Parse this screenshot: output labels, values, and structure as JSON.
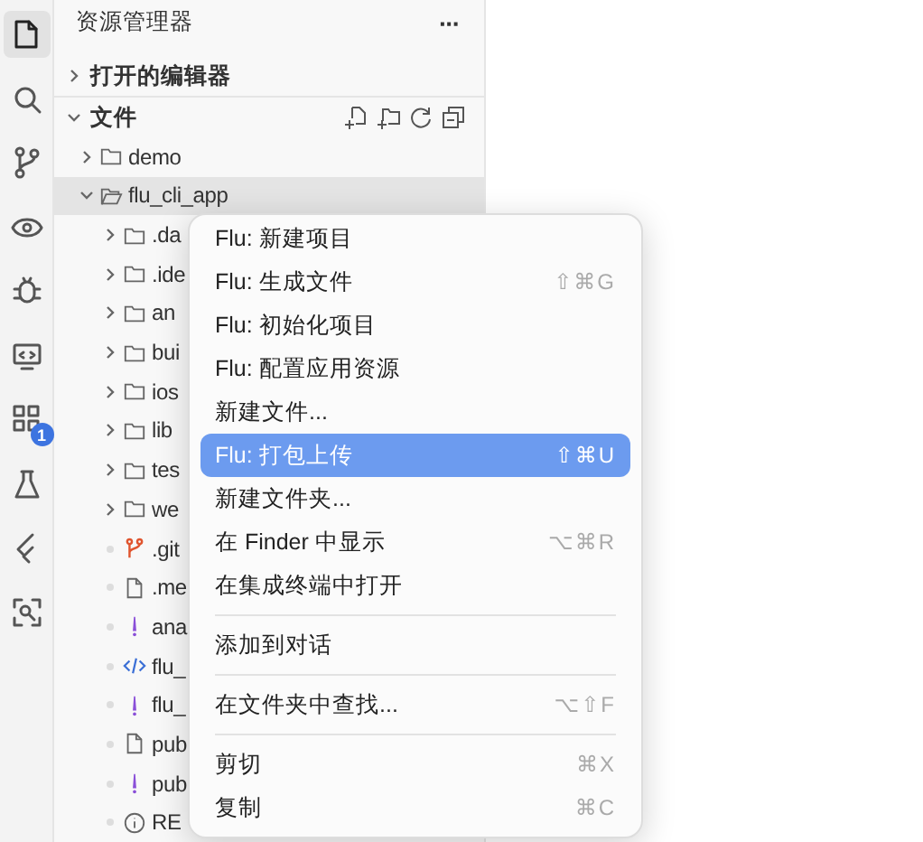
{
  "activity_bar": [
    {
      "kind": "files",
      "selected": true
    },
    {
      "kind": "search",
      "selected": false
    },
    {
      "kind": "source-control",
      "selected": false
    },
    {
      "kind": "eye",
      "selected": false
    },
    {
      "kind": "debug",
      "selected": false
    },
    {
      "kind": "remote",
      "selected": false
    },
    {
      "kind": "extensions",
      "selected": false,
      "badge": "1"
    },
    {
      "kind": "flask",
      "selected": false
    },
    {
      "kind": "flutter",
      "selected": false
    },
    {
      "kind": "scan",
      "selected": false
    }
  ],
  "sidebar": {
    "title": "资源管理器",
    "more": "···",
    "sections": [
      {
        "title": "打开的编辑器",
        "expanded": false
      },
      {
        "title": "文件",
        "expanded": true
      }
    ],
    "files": [
      {
        "name": "demo",
        "kind": "folder",
        "expanded": false,
        "selected": false
      },
      {
        "name": "flu_cli_app",
        "kind": "folder",
        "expanded": true,
        "selected": true,
        "children": [
          {
            "name": ".da",
            "kind": "folder",
            "expanded": false,
            "selected": false
          },
          {
            "name": ".ide",
            "kind": "folder",
            "expanded": false,
            "selected": false
          },
          {
            "name": "an",
            "kind": "folder",
            "expanded": false,
            "selected": false
          },
          {
            "name": "bui",
            "kind": "folder",
            "expanded": false,
            "selected": false
          },
          {
            "name": "ios",
            "kind": "folder",
            "expanded": false,
            "selected": false
          },
          {
            "name": "lib",
            "kind": "folder",
            "expanded": false,
            "selected": false
          },
          {
            "name": "tes",
            "kind": "folder",
            "expanded": false,
            "selected": false
          },
          {
            "name": "we",
            "kind": "folder",
            "expanded": false,
            "selected": false
          },
          {
            "name": ".git",
            "kind": "git",
            "selected": false
          },
          {
            "name": ".me",
            "kind": "file",
            "selected": false
          },
          {
            "name": "ana",
            "kind": "yaml",
            "selected": false
          },
          {
            "name": "flu_",
            "kind": "xml",
            "selected": false
          },
          {
            "name": "flu_",
            "kind": "yaml",
            "selected": false
          },
          {
            "name": "pub",
            "kind": "file",
            "selected": false
          },
          {
            "name": "pub",
            "kind": "yaml",
            "selected": false
          },
          {
            "name": "RE",
            "kind": "info",
            "selected": false
          }
        ]
      }
    ]
  },
  "context_menu": {
    "groups": [
      [
        {
          "label": "Flu: 新建项目",
          "selected": false
        },
        {
          "label": "Flu: 生成文件",
          "shortcut": "⇧⌘G",
          "selected": false
        },
        {
          "label": "Flu: 初始化项目",
          "selected": false
        },
        {
          "label": "Flu: 配置应用资源",
          "selected": false
        },
        {
          "label": "新建文件...",
          "selected": false
        },
        {
          "label": "Flu: 打包上传",
          "shortcut": "⇧⌘U",
          "selected": true
        },
        {
          "label": "新建文件夹...",
          "selected": false
        },
        {
          "label": "在 Finder 中显示",
          "shortcut": "⌥⌘R",
          "selected": false
        },
        {
          "label": "在集成终端中打开",
          "selected": false
        }
      ],
      [
        {
          "label": "添加到对话",
          "selected": false
        }
      ],
      [
        {
          "label": "在文件夹中查找...",
          "shortcut": "⌥⇧F",
          "selected": false
        }
      ],
      [
        {
          "label": "剪切",
          "shortcut": "⌘X",
          "selected": false
        },
        {
          "label": "复制",
          "shortcut": "⌘C",
          "selected": false
        }
      ]
    ]
  }
}
